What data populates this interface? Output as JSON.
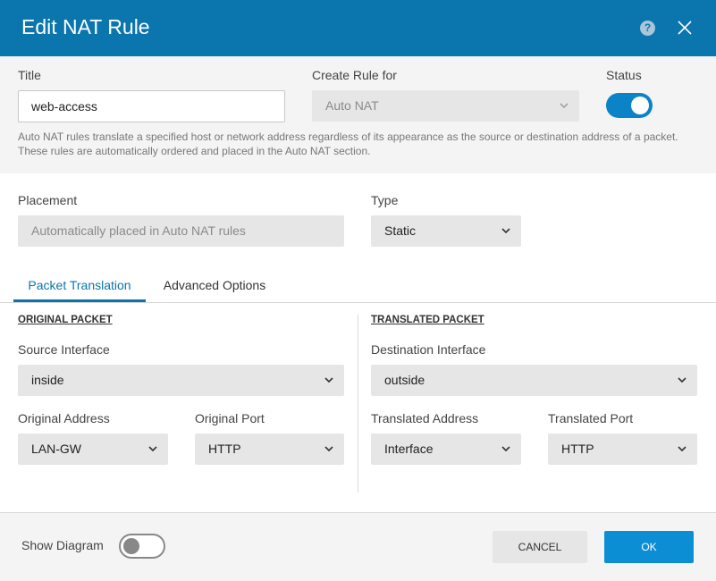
{
  "dialog": {
    "title": "Edit NAT Rule",
    "help_symbol": "?"
  },
  "top": {
    "title_label": "Title",
    "title_value": "web-access",
    "create_rule_label": "Create Rule for",
    "create_rule_value": "Auto NAT",
    "status_label": "Status",
    "status_on": true,
    "help_text": "Auto NAT rules translate a specified host or network address regardless of its appearance as the source or destination address of a packet. These rules are automatically ordered and placed in the Auto NAT section."
  },
  "placement": {
    "label": "Placement",
    "value": "Automatically placed in Auto NAT rules"
  },
  "type": {
    "label": "Type",
    "value": "Static"
  },
  "tabs": [
    {
      "label": "Packet Translation",
      "active": true
    },
    {
      "label": "Advanced Options",
      "active": false
    }
  ],
  "original": {
    "heading": "ORIGINAL PACKET",
    "source_interface_label": "Source Interface",
    "source_interface_value": "inside",
    "address_label": "Original Address",
    "address_value": "LAN-GW",
    "port_label": "Original Port",
    "port_value": "HTTP"
  },
  "translated": {
    "heading": "TRANSLATED PACKET",
    "dest_interface_label": "Destination Interface",
    "dest_interface_value": "outside",
    "address_label": "Translated Address",
    "address_value": "Interface",
    "port_label": "Translated Port",
    "port_value": "HTTP"
  },
  "footer": {
    "show_diagram_label": "Show Diagram",
    "show_diagram_on": false,
    "cancel_label": "CANCEL",
    "ok_label": "OK"
  },
  "colors": {
    "header": "#0b75ad",
    "accent": "#0c83c7",
    "ok_button": "#0c8ed4"
  }
}
